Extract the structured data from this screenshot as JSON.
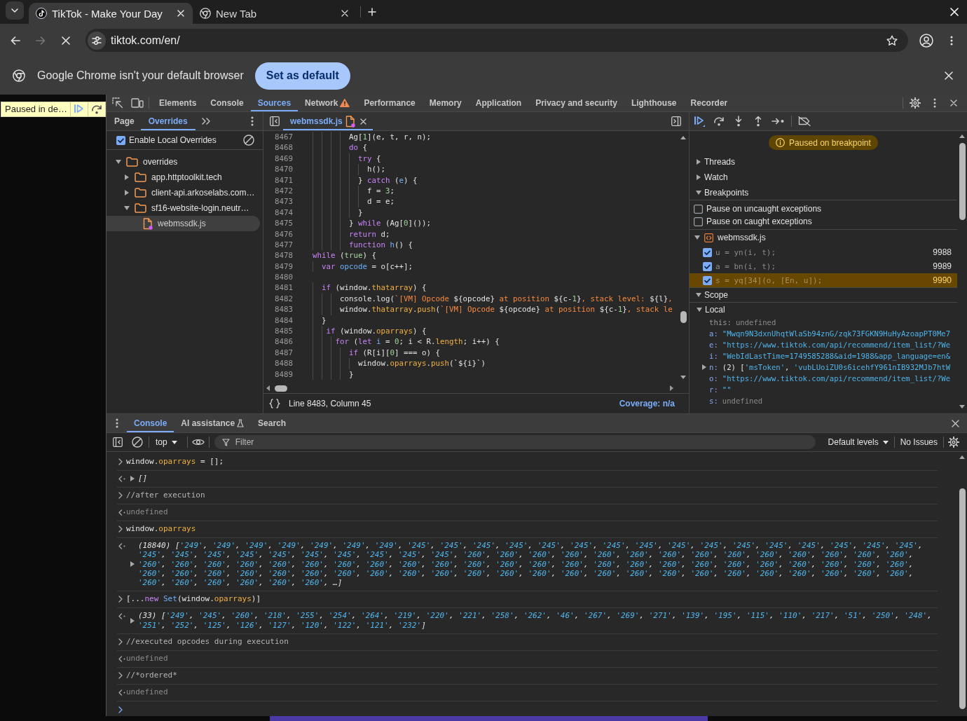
{
  "browser": {
    "tabs": [
      {
        "title": "TikTok - Make Your Day",
        "kind": "site",
        "selected": true
      },
      {
        "title": "New Tab",
        "kind": "new-tab",
        "selected": false
      }
    ],
    "toolbar": {
      "url": "tiktok.com/en/",
      "loading": true,
      "can_go_forward": false
    },
    "infobar": {
      "message": "Google Chrome isn't your default browser",
      "button": "Set as default"
    }
  },
  "page": {
    "paused_overlay": {
      "label": "Paused in de…"
    }
  },
  "devtools": {
    "panels": [
      {
        "label": "Elements",
        "selected": false,
        "warning": false
      },
      {
        "label": "Console",
        "selected": false,
        "warning": false
      },
      {
        "label": "Sources",
        "selected": true,
        "warning": false
      },
      {
        "label": "Network",
        "selected": false,
        "warning": true
      },
      {
        "label": "Performance",
        "selected": false,
        "warning": false
      },
      {
        "label": "Memory",
        "selected": false,
        "warning": false
      },
      {
        "label": "Application",
        "selected": false,
        "warning": false
      },
      {
        "label": "Privacy and security",
        "selected": false,
        "warning": false
      },
      {
        "label": "Lighthouse",
        "selected": false,
        "warning": false
      },
      {
        "label": "Recorder",
        "selected": false,
        "warning": false
      }
    ],
    "sources": {
      "navigator": {
        "tabs": [
          {
            "label": "Page",
            "selected": false
          },
          {
            "label": "Overrides",
            "selected": true
          }
        ],
        "enable_overrides": {
          "label": "Enable Local Overrides",
          "checked": true
        },
        "tree": [
          {
            "label": "overrides",
            "kind": "folder",
            "expanded": true,
            "selected": false,
            "children": [
              {
                "label": "app.httptoolkit.tech",
                "kind": "folder",
                "expanded": false,
                "selected": false
              },
              {
                "label": "client-api.arkoselabs.com…",
                "kind": "folder",
                "expanded": false,
                "selected": false
              },
              {
                "label": "sf16-website-login.neutr…",
                "kind": "folder",
                "expanded": true,
                "selected": false,
                "children": [
                  {
                    "label": "webmssdk.js",
                    "kind": "file",
                    "modified": true,
                    "selected": true
                  }
                ]
              }
            ]
          }
        ]
      },
      "editor": {
        "tabs": [
          {
            "label": "webmssdk.js",
            "modified": true,
            "selected": true
          }
        ],
        "lines": [
          {
            "number": "8467",
            "tokens": [
              {
                "kind": "plain",
                "text": "        Ag["
              },
              {
                "kind": "number",
                "text": "1"
              },
              {
                "kind": "plain",
                "text": "](e, t, r, n);"
              }
            ]
          },
          {
            "number": "8468",
            "tokens": [
              {
                "kind": "keyword",
                "text": "        do"
              },
              {
                "kind": "plain",
                "text": " {"
              }
            ]
          },
          {
            "number": "8469",
            "tokens": [
              {
                "kind": "keyword",
                "text": "          try"
              },
              {
                "kind": "plain",
                "text": " {"
              }
            ]
          },
          {
            "number": "8470",
            "tokens": [
              {
                "kind": "plain",
                "text": "            h();"
              }
            ]
          },
          {
            "number": "8471",
            "tokens": [
              {
                "kind": "plain",
                "text": "          } "
              },
              {
                "kind": "keyword",
                "text": "catch"
              },
              {
                "kind": "plain",
                "text": " ("
              },
              {
                "kind": "def",
                "text": "e"
              },
              {
                "kind": "plain",
                "text": ") {"
              }
            ]
          },
          {
            "number": "8472",
            "tokens": [
              {
                "kind": "plain",
                "text": "            f = "
              },
              {
                "kind": "number",
                "text": "3"
              },
              {
                "kind": "plain",
                "text": ";"
              }
            ]
          },
          {
            "number": "8473",
            "tokens": [
              {
                "kind": "plain",
                "text": "            d = e;"
              }
            ]
          },
          {
            "number": "8474",
            "tokens": [
              {
                "kind": "plain",
                "text": "          }"
              }
            ]
          },
          {
            "number": "8475",
            "tokens": [
              {
                "kind": "plain",
                "text": "        } "
              },
              {
                "kind": "keyword",
                "text": "while"
              },
              {
                "kind": "plain",
                "text": " (Ag["
              },
              {
                "kind": "number",
                "text": "0"
              },
              {
                "kind": "plain",
                "text": "]());"
              }
            ]
          },
          {
            "number": "8476",
            "tokens": [
              {
                "kind": "keyword",
                "text": "        return"
              },
              {
                "kind": "plain",
                "text": " d;"
              }
            ]
          },
          {
            "number": "8477",
            "tokens": [
              {
                "kind": "keyword",
                "text": "        function "
              },
              {
                "kind": "def",
                "text": "h"
              },
              {
                "kind": "plain",
                "text": "() {"
              }
            ]
          },
          {
            "number": "8478",
            "tokens": [
              {
                "kind": "keyword",
                "text": "while"
              },
              {
                "kind": "plain",
                "text": " ("
              },
              {
                "kind": "atom",
                "text": "true"
              },
              {
                "kind": "plain",
                "text": ") {"
              }
            ]
          },
          {
            "number": "8479",
            "tokens": [
              {
                "kind": "keyword",
                "text": "  var "
              },
              {
                "kind": "def",
                "text": "opcode"
              },
              {
                "kind": "plain",
                "text": " = o[c++];"
              }
            ]
          },
          {
            "number": "8480"
          },
          {
            "number": "8481",
            "tokens": [
              {
                "kind": "keyword",
                "text": "  if"
              },
              {
                "kind": "plain",
                "text": " (window."
              },
              {
                "kind": "property",
                "text": "thatarray"
              },
              {
                "kind": "plain",
                "text": ") {"
              }
            ]
          },
          {
            "number": "8482",
            "tokens": [
              {
                "kind": "plain",
                "text": "      console.log("
              },
              {
                "kind": "string",
                "text": "`[VM] Opcode "
              },
              {
                "kind": "plain",
                "text": "${opcode}"
              },
              {
                "kind": "string",
                "text": " at position "
              },
              {
                "kind": "plain",
                "text": "${c-"
              },
              {
                "kind": "number",
                "text": "1"
              },
              {
                "kind": "plain",
                "text": "}"
              },
              {
                "kind": "string",
                "text": ", stack level: "
              },
              {
                "kind": "plain",
                "text": "${l}"
              },
              {
                "kind": "string",
                "text": ","
              }
            ]
          },
          {
            "number": "8483",
            "tokens": [
              {
                "kind": "plain",
                "text": "      window."
              },
              {
                "kind": "property",
                "text": "thatarray"
              },
              {
                "kind": "plain",
                "text": "."
              },
              {
                "kind": "property",
                "text": "push"
              },
              {
                "kind": "plain",
                "text": "("
              },
              {
                "kind": "string",
                "text": "`[VM] Opcode "
              },
              {
                "kind": "plain",
                "text": "${opcode}"
              },
              {
                "kind": "string",
                "text": " at position "
              },
              {
                "kind": "plain",
                "text": "${c-"
              },
              {
                "kind": "number",
                "text": "1"
              },
              {
                "kind": "plain",
                "text": "}"
              },
              {
                "kind": "string",
                "text": ", stack le"
              }
            ]
          },
          {
            "number": "8484",
            "tokens": [
              {
                "kind": "plain",
                "text": "  }"
              }
            ]
          },
          {
            "number": "8485",
            "tokens": [
              {
                "kind": "keyword",
                "text": "   if"
              },
              {
                "kind": "plain",
                "text": " (window."
              },
              {
                "kind": "property",
                "text": "oparrays"
              },
              {
                "kind": "plain",
                "text": ") {"
              }
            ]
          },
          {
            "number": "8486",
            "tokens": [
              {
                "kind": "keyword",
                "text": "     for"
              },
              {
                "kind": "plain",
                "text": " ("
              },
              {
                "kind": "keyword",
                "text": "let "
              },
              {
                "kind": "def",
                "text": "i"
              },
              {
                "kind": "plain",
                "text": " = "
              },
              {
                "kind": "number",
                "text": "0"
              },
              {
                "kind": "plain",
                "text": "; i < R."
              },
              {
                "kind": "property",
                "text": "length"
              },
              {
                "kind": "plain",
                "text": "; i++) {"
              }
            ]
          },
          {
            "number": "8487",
            "tokens": [
              {
                "kind": "keyword",
                "text": "        if"
              },
              {
                "kind": "plain",
                "text": " (R[i]["
              },
              {
                "kind": "number",
                "text": "0"
              },
              {
                "kind": "plain",
                "text": "] === o) {"
              }
            ]
          },
          {
            "number": "8488",
            "tokens": [
              {
                "kind": "plain",
                "text": "          window."
              },
              {
                "kind": "property",
                "text": "oparrays"
              },
              {
                "kind": "plain",
                "text": "."
              },
              {
                "kind": "property",
                "text": "push"
              },
              {
                "kind": "plain",
                "text": "(`${i}`)"
              }
            ]
          },
          {
            "number": "8489",
            "tokens": [
              {
                "kind": "plain",
                "text": "        }"
              }
            ]
          }
        ],
        "status": {
          "position": "Line 8483, Column 45",
          "coverage": "Coverage: n/a"
        }
      },
      "debugger": {
        "paused_message": "Paused on breakpoint",
        "sections": [
          {
            "kind": "plain",
            "label": "Threads",
            "expanded": false
          },
          {
            "kind": "plain",
            "label": "Watch",
            "expanded": false
          },
          {
            "kind": "breakpoints",
            "label": "Breakpoints",
            "expanded": true,
            "options": [
              {
                "label": "Pause on uncaught exceptions",
                "checked": false
              },
              {
                "label": "Pause on caught exceptions",
                "checked": false
              }
            ],
            "files": [
              {
                "name": "webmssdk.js",
                "expanded": true,
                "items": [
                  {
                    "code": "u = yn(i, t);",
                    "line": "9988",
                    "checked": true,
                    "selected": false
                  },
                  {
                    "code": "a = bn(i, t);",
                    "line": "9989",
                    "checked": true,
                    "selected": false
                  },
                  {
                    "code": "s = yq[34](o, [En, u]);",
                    "line": "9990",
                    "checked": true,
                    "selected": true
                  }
                ]
              }
            ]
          },
          {
            "kind": "scope",
            "label": "Scope",
            "expanded": true,
            "groups": [
              {
                "label": "Local",
                "expanded": true,
                "variables": [
                  {
                    "name": "this:",
                    "value": "undefined",
                    "kind": "undefined",
                    "dimmed": true
                  },
                  {
                    "name": "a:",
                    "value": "\"Mwqn9N3dxnUhqtWlaSb94znG/zqk73FGKN9HuHyAzoapPT0Me7",
                    "kind": "string",
                    "dimmed": false
                  },
                  {
                    "name": "e:",
                    "value": "\"https://www.tiktok.com/api/recommend/item_list/?We",
                    "kind": "string",
                    "dimmed": false
                  },
                  {
                    "name": "i:",
                    "value": "\"WebIdLastTime=1749585288&aid=1988&app_language=en&",
                    "kind": "string",
                    "dimmed": false
                  },
                  {
                    "name": "n:",
                    "value": "(2) ['msToken', 'vubLUoiZU0s6icehfY961nIB932MJb7htW",
                    "kind": "object",
                    "expanded": false,
                    "dimmed": false
                  },
                  {
                    "name": "o:",
                    "value": "\"https://www.tiktok.com/api/recommend/item_list/?We",
                    "kind": "string",
                    "dimmed": false
                  },
                  {
                    "name": "r:",
                    "value": "\"\"",
                    "kind": "string",
                    "dimmed": false
                  },
                  {
                    "name": "s:",
                    "value": "undefined",
                    "kind": "undefined",
                    "dimmed": false
                  }
                ]
              }
            ]
          }
        ]
      }
    },
    "drawer": {
      "tabs": [
        {
          "label": "Console",
          "selected": true,
          "experimental": false
        },
        {
          "label": "AI assistance",
          "selected": false,
          "experimental": true
        },
        {
          "label": "Search",
          "selected": false,
          "experimental": false
        }
      ],
      "console": {
        "context": "top",
        "filter": {
          "placeholder": "Filter"
        },
        "levels": "Default levels",
        "issues": "No Issues",
        "messages": [
          {
            "kind": "input",
            "tokens": [
              {
                "kind": "plain",
                "text": "window."
              },
              {
                "kind": "property",
                "text": "oparrays"
              },
              {
                "kind": "plain",
                "text": " = [];"
              }
            ]
          },
          {
            "kind": "array",
            "text": "[]",
            "expanded": false
          },
          {
            "kind": "input",
            "tokens": [
              {
                "kind": "comment",
                "text": "//after execution"
              }
            ]
          },
          {
            "kind": "undefined",
            "text": "undefined"
          },
          {
            "kind": "input",
            "tokens": [
              {
                "kind": "plain",
                "text": "window."
              },
              {
                "kind": "property",
                "text": "oparrays"
              }
            ]
          },
          {
            "kind": "array",
            "text": "(18840) ['249', '249', '249', '249', '249', '249', '249', '245', '245', '245', '245', '245', '245', '245', '245', '245', '245', '245', '245', '245', '245', '245', '245', '245', '245', '245', '245', '245', '245', '245', '245', '245', '245', '260', '260', '260', '260', '260', '260', '260', '260', '260', '260', '260', '260', '260', '260', '260', '260', '260', '260', '260', '260', '260', '260', '260', '260', '260', '260', '260', '260', '260', '260', '260', '260', '260', '260', '260', '260', '260', '260', '260', '260', '260', '260', '260', '260', '260', '260', '260', '260', '260', '260', '260', '260', '260', '260', '260', '260', '260', '260', '260', '260', '260', '260', '260', '260', '260', '260', '260', '260', …]",
            "expanded": false
          },
          {
            "kind": "input",
            "tokens": [
              {
                "kind": "plain",
                "text": "[..."
              },
              {
                "kind": "keyword",
                "text": "new "
              },
              {
                "kind": "def",
                "text": "Set"
              },
              {
                "kind": "plain",
                "text": "(window."
              },
              {
                "kind": "property",
                "text": "oparrays"
              },
              {
                "kind": "plain",
                "text": ")]"
              }
            ]
          },
          {
            "kind": "array",
            "text": "(33) ['249', '245', '260', '218', '255', '254', '264', '219', '220', '221', '258', '262', '46', '267', '269', '271', '139', '195', '115', '110', '217', '51', '250', '248', '251', '252', '125', '126', '127', '120', '122', '121', '232']",
            "expanded": false
          },
          {
            "kind": "input",
            "tokens": [
              {
                "kind": "comment",
                "text": "//executed opcodes during execution"
              }
            ]
          },
          {
            "kind": "undefined",
            "text": "undefined"
          },
          {
            "kind": "input",
            "tokens": [
              {
                "kind": "comment",
                "text": "//*ordered*"
              }
            ]
          },
          {
            "kind": "undefined",
            "text": "undefined"
          }
        ]
      }
    }
  }
}
